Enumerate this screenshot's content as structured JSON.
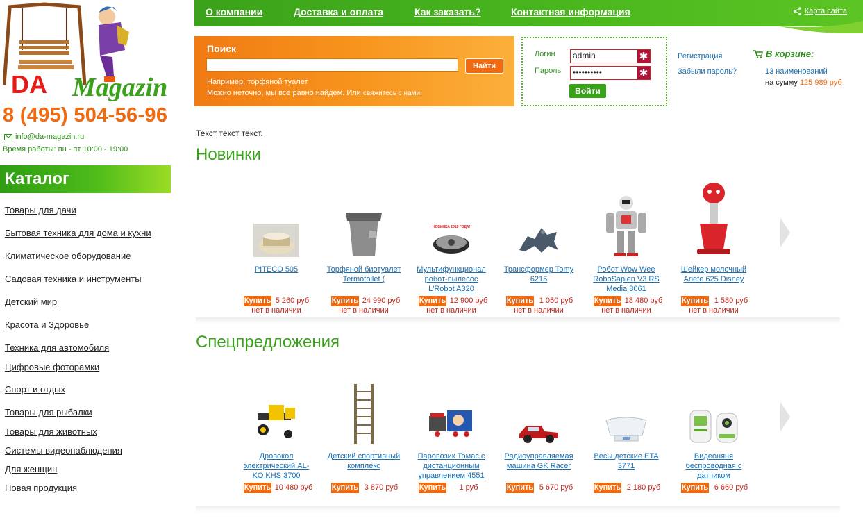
{
  "brand": {
    "logo_text_da": "DA",
    "logo_text_magazin": "Magazin"
  },
  "contacts": {
    "phone": "8 (495) 504-56-96",
    "email": "info@da-magazin.ru",
    "hours": "Время работы: пн - пт 10:00 - 19:00"
  },
  "catalog": {
    "title": "Каталог",
    "items": [
      "Товары для дачи",
      "Бытовая техника для дома и кухни",
      "Климатическое оборудование",
      "Садовая техника и инструменты",
      "Детский мир",
      "Красота и Здоровье",
      "Техника для автомобиля",
      "Цифровые фоторамки",
      "Спорт и отдых",
      "Товары для рыбалки",
      "Товары для животных",
      "Системы видеонаблюдения",
      "Для женщин",
      "Новая продукция"
    ]
  },
  "nav": {
    "items": [
      "О компании",
      "Доставка и оплата",
      "Как заказать?",
      "Контактная информация"
    ],
    "sitemap": "Карта сайта"
  },
  "search": {
    "title": "Поиск",
    "value": "",
    "button": "Найти",
    "hint": "Например, торфяной туалет",
    "hint2_prefix": "Можно неточно, мы все равно найдем. Или",
    "hint2_link": "свяжитесь с нами."
  },
  "login": {
    "login_label": "Логин",
    "password_label": "Пароль",
    "login_value": "admin",
    "password_value": "••••••••••",
    "button": "Войти",
    "register": "Регистрация",
    "forgot": "Забыли пароль?"
  },
  "cart": {
    "title": "В корзине:",
    "count": "13 наименований",
    "sum_prefix": "на сумму",
    "sum": "125 989 руб"
  },
  "intro": "Текст текст текст.",
  "sections": [
    {
      "title": "Новинки",
      "products": [
        {
          "name": "PITECO 505",
          "buy": "Купить",
          "price": "5 260 руб",
          "availability": "нет в наличии"
        },
        {
          "name": "Торфяной биотуалет Termotoilet (",
          "buy": "Купить",
          "price": "24 990 руб",
          "availability": "нет в наличии"
        },
        {
          "name": "Мультифункционал робот-пылесос L'Robot A320",
          "buy": "Купить",
          "price": "12 900 руб",
          "availability": "нет в наличии",
          "badge": "НОВИНКА 2012 ГОДА!"
        },
        {
          "name": "Трансформер Tomy 6216",
          "buy": "Купить",
          "price": "1 050 руб",
          "availability": "нет в наличии"
        },
        {
          "name": "Робот Wow Wee RoboSapien V3 RS Media 8061",
          "buy": "Купить",
          "price": "18 480 руб",
          "availability": "нет в наличии"
        },
        {
          "name": "Шейкер молочный Ariete 625 Disney",
          "buy": "Купить",
          "price": "1 580 руб",
          "availability": "нет в наличии"
        }
      ]
    },
    {
      "title": "Спецпредложения",
      "products": [
        {
          "name": "Дровокол электрический AL-KO KHS 3700",
          "buy": "Купить",
          "price": "10 480 руб"
        },
        {
          "name": "Детский спортивный комплекс",
          "buy": "Купить",
          "price": "3 870 руб"
        },
        {
          "name": "Паровозик Томас с дистанционным управлением 4551",
          "buy": "Купить",
          "price": "1 руб"
        },
        {
          "name": "Радиоуправляемая машина GK Racer",
          "buy": "Купить",
          "price": "5 670 руб"
        },
        {
          "name": "Весы детские ETA 3771",
          "buy": "Купить",
          "price": "2 180 руб"
        },
        {
          "name": "Видеоняня беспроводная с датчиком",
          "buy": "Купить",
          "price": "6 660 руб"
        }
      ]
    }
  ],
  "colors": {
    "green": "#3aa21a",
    "orange": "#f26a10",
    "price_red": "#c0271a",
    "link_blue": "#1a6fb0"
  }
}
